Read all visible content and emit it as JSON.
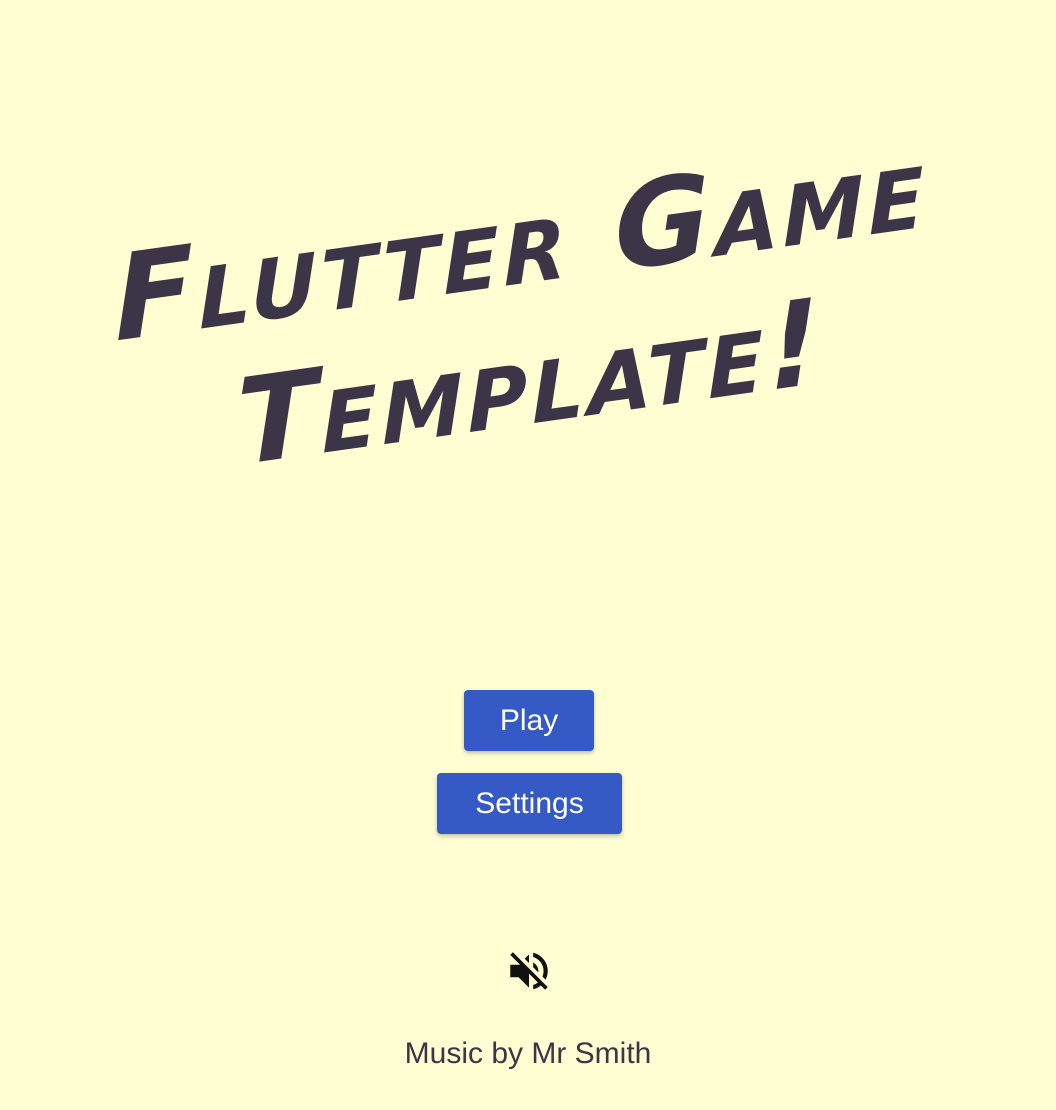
{
  "title": {
    "line1": "Flutter Game",
    "line2": "Template!"
  },
  "menu": {
    "play_label": "Play",
    "settings_label": "Settings"
  },
  "audio": {
    "icon": "volume-off-icon",
    "muted": true
  },
  "credits": {
    "text": "Music by Mr Smith"
  },
  "colors": {
    "background": "#fffdd1",
    "title": "#3b3547",
    "button": "#3559c5",
    "button_text": "#ffffff"
  }
}
